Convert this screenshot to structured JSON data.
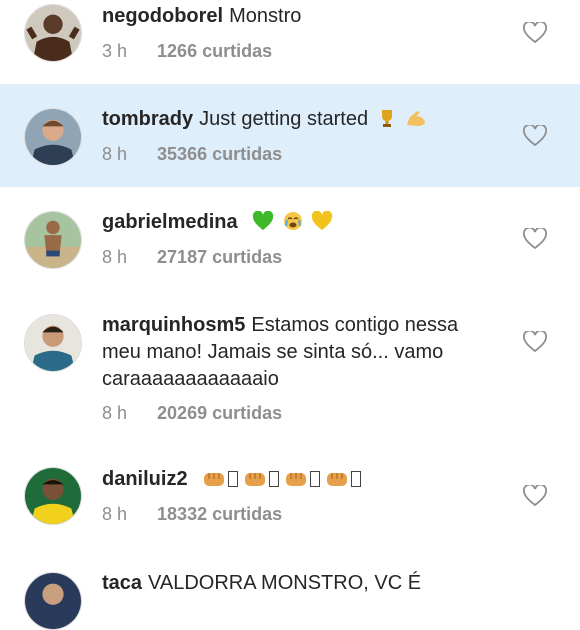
{
  "comments": [
    {
      "username": "negodoborel",
      "text": "Monstro",
      "time": "3 h",
      "likes": "1266 curtidas"
    },
    {
      "username": "tombrady",
      "text": "Just getting started",
      "time": "8 h",
      "likes": "35366 curtidas",
      "emojis": [
        "trophy",
        "flexed-biceps"
      ]
    },
    {
      "username": "gabrielmedina",
      "text": "",
      "time": "8 h",
      "likes": "27187 curtidas",
      "emojis": [
        "green-heart",
        "crying-face",
        "yellow-heart"
      ]
    },
    {
      "username": "marquinhosm5",
      "text": "Estamos contigo nessa meu mano! Jamais se sinta só... vamo caraaaaaaaaaaaaio",
      "time": "8 h",
      "likes": "20269 curtidas"
    },
    {
      "username": "daniluiz2",
      "text": "",
      "time": "8 h",
      "likes": "18332 curtidas",
      "emojis": [
        "fist",
        "fist",
        "fist",
        "fist"
      ]
    },
    {
      "username": "taca",
      "text": "VALDORRA MONSTRO, VC É"
    }
  ],
  "colors": {
    "highlight": "#dfeefb",
    "meta": "#8e8e8e",
    "text": "#262626"
  }
}
